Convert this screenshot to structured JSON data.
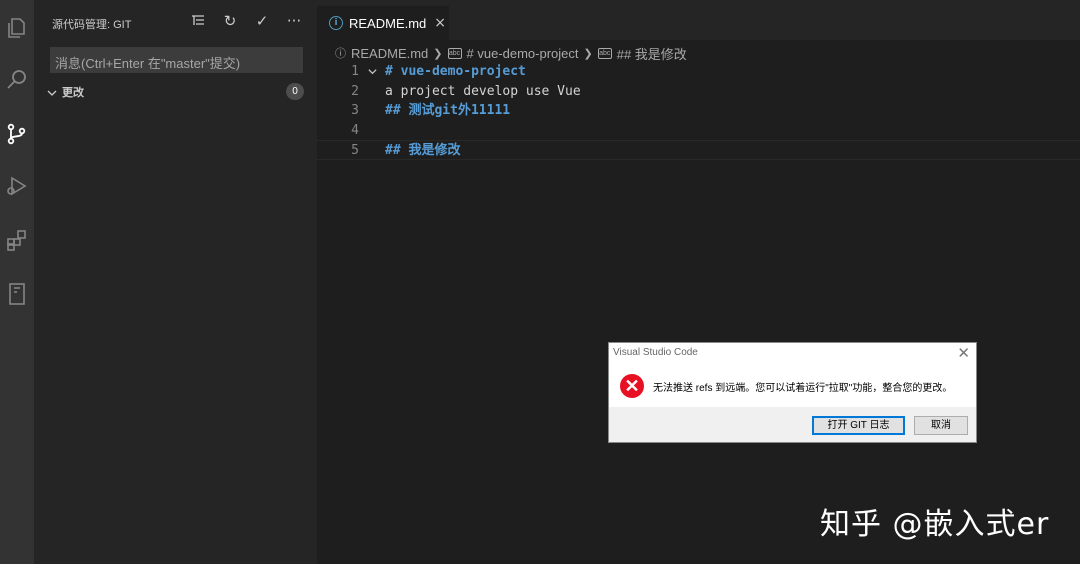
{
  "activity_bar": {
    "items": [
      {
        "icon": "files-icon"
      },
      {
        "icon": "search-icon"
      },
      {
        "icon": "source-control-icon"
      },
      {
        "icon": "run-debug-icon"
      },
      {
        "icon": "extensions-icon"
      },
      {
        "icon": "remote-explorer-icon"
      }
    ],
    "active_color": "#ffffff"
  },
  "sidebar": {
    "title": "源代码管理: GIT",
    "actions": [
      {
        "icon": "tree-view-icon",
        "glyph": "⁝☰"
      },
      {
        "icon": "refresh-icon",
        "glyph": "↻"
      },
      {
        "icon": "commit-check-icon",
        "glyph": "✓"
      },
      {
        "icon": "more-actions-icon",
        "glyph": "···"
      }
    ],
    "commit_placeholder": "消息(Ctrl+Enter 在\"master\"提交)",
    "changes_label": "更改",
    "changes_count": "0"
  },
  "editor": {
    "tab": {
      "label": "README.md",
      "close": "×"
    },
    "breadcrumb": {
      "file": "README.md",
      "items": [
        "# vue-demo-project",
        "## 我是修改"
      ]
    },
    "lines": [
      {
        "num": "1",
        "text": "# vue-demo-project",
        "style": "heading",
        "fold": true
      },
      {
        "num": "2",
        "text": "a project develop use Vue",
        "style": "plain"
      },
      {
        "num": "3",
        "text": "## 测试git外11111",
        "style": "heading"
      },
      {
        "num": "4",
        "text": "",
        "style": "plain"
      },
      {
        "num": "5",
        "text": "## 我是修改",
        "style": "heading",
        "current": true
      }
    ]
  },
  "dialog": {
    "title": "Visual Studio Code",
    "message": "无法推送 refs 到远端。您可以试着运行\"拉取\"功能，整合您的更改。",
    "buttons": {
      "open_log": "打开 GIT 日志",
      "cancel": "取消"
    }
  },
  "watermark": "知乎 @嵌入式er",
  "colors": {
    "activity_bg": "#333333",
    "sidebar_bg": "#252526",
    "editor_bg": "#1e1e1e",
    "heading": "#569cd6",
    "error": "#e81123"
  }
}
